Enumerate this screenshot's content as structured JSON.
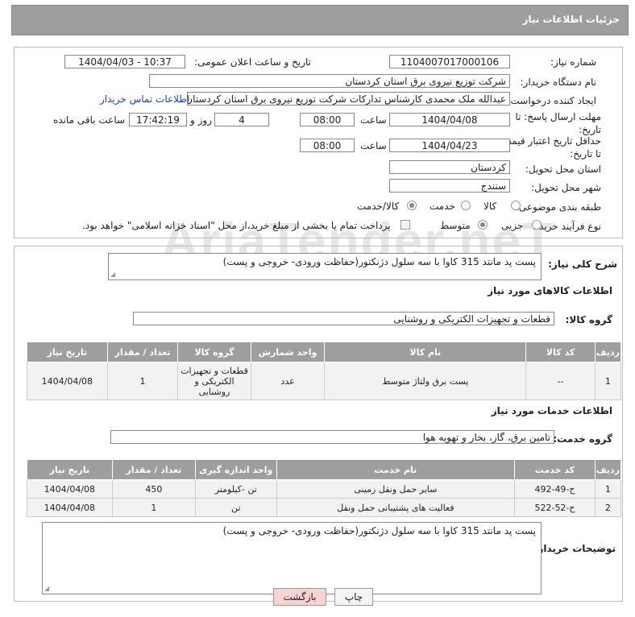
{
  "header": {
    "title": "جزئیات اطلاعات نیاز"
  },
  "watermark": "AriaTender.neT",
  "form": {
    "need_number_label": "شماره نیاز:",
    "need_number": "1104007017000106",
    "announce_label": "تاریخ و ساعت اعلان عمومی:",
    "announce_value": "1404/04/03 - 10:37",
    "buyer_label": "نام دستگاه خریدار:",
    "buyer_value": "شرکت توزیع نیروی برق استان کردستان",
    "creator_label": "ایجاد کننده درخواست:",
    "creator_value": "عبدالله ملک محمدی کارشناس تدارکات شرکت توزیع نیروی برق استان کردستان",
    "contact_link": "اطلاعات تماس خریدار",
    "deadline_label": "مهلت ارسال پاسخ: تا تاریخ:",
    "deadline_date": "1404/04/08",
    "time_label": "ساعت",
    "deadline_time": "08:00",
    "days_value": "4",
    "days_label": "روز و",
    "remaining_time": "17:42:19",
    "remaining_label": "ساعت باقی مانده",
    "validity_label": "حداقل تاریخ اعتبار قیمت: تا تاریخ:",
    "validity_date": "1404/04/23",
    "validity_time": "08:00",
    "province_label": "استان محل تحویل:",
    "province_value": "کردستان",
    "city_label": "شهر محل تحویل:",
    "city_value": "سنندج",
    "category_label": "طبقه بندی موضوعی:",
    "category_options": [
      "کالا",
      "خدمت",
      "کالا/خدمت"
    ],
    "category_selected": "کالا/خدمت",
    "process_label": "نوع فرآیند خرید :",
    "process_options": [
      "جزیی",
      "متوسط"
    ],
    "process_selected": "متوسط",
    "payment_note": "پرداخت تمام یا بخشی از مبلغ خرید،از محل \"اسناد خزانه اسلامی\" خواهد بود."
  },
  "description": {
    "label": "شرح کلی نیاز:",
    "value": "پست پد مانتد 315 کاوا با سه سلول دژنکتور(حفاظت ورودی- خروجی و پست)"
  },
  "goods": {
    "section_title": "اطلاعات کالاهای مورد نیاز",
    "group_label": "گروه کالا:",
    "group_value": "قطعات و تجهیزات الکتریکی و روشنایی",
    "columns": [
      "ردیف",
      "کد کالا",
      "نام کالا",
      "واحد شمارش",
      "گروه کالا",
      "تعداد / مقدار",
      "تاریخ نیاز"
    ],
    "rows": [
      [
        "1",
        "--",
        "پست برق ولتاژ متوسط",
        "عدد",
        "قطعات و تجهیزات الکتریکی و روشنایی",
        "1",
        "1404/04/08"
      ]
    ]
  },
  "services": {
    "section_title": "اطلاعات خدمات مورد نیاز",
    "group_label": "گروه خدمت:",
    "group_value": "تامین برق، گاز، بخار و تهویه هوا",
    "columns": [
      "ردیف",
      "کد خدمت",
      "نام خدمت",
      "واحد اندازه گیری",
      "تعداد / مقدار",
      "تاریخ نیاز"
    ],
    "rows": [
      [
        "1",
        "ح-49-492",
        "سایر حمل ونقل زمینی",
        "تن -کیلومتر",
        "450",
        "1404/04/08"
      ],
      [
        "2",
        "ح-52-522",
        "فعالیت های پشتیبانی حمل ونقل",
        "تن",
        "1",
        "1404/04/08"
      ]
    ]
  },
  "buyer_notes": {
    "label": "توضیحات خریدار:",
    "value": "پست پد مانتد 315 کاوا با سه سلول دژنکتور(حفاظت ورودی- خروجی و پست)"
  },
  "buttons": {
    "print": "چاپ",
    "back": "بازگشت"
  }
}
